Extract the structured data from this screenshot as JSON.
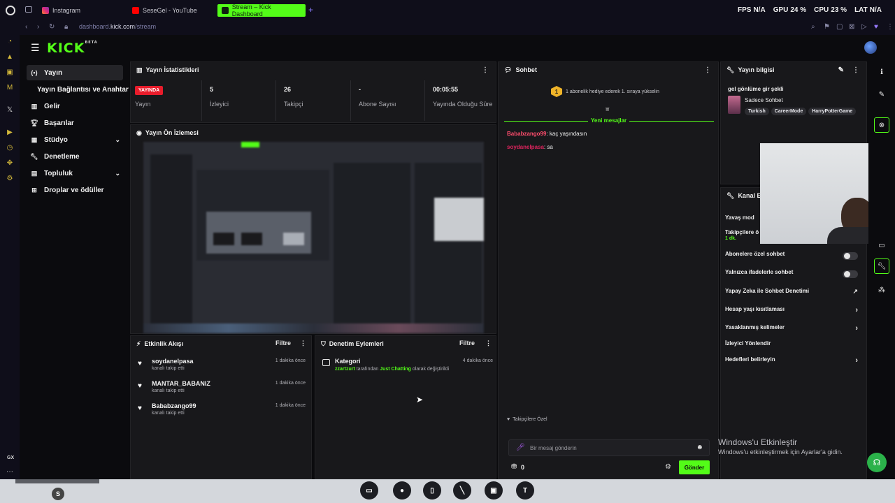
{
  "browser": {
    "tabs": [
      {
        "label": "Instagram",
        "color": "#d6249f"
      },
      {
        "label": "SeseGel - YouTube",
        "color": "#ff0000"
      },
      {
        "label": "Stream – Kick Dashboard",
        "color": "#53fc18"
      }
    ],
    "url_prefix": "dashboard.",
    "url_host": "kick.com",
    "url_path": "/stream",
    "stats_overlay": {
      "fps_label": "FPS",
      "fps_value": "N/A",
      "gpu_label": "GPU",
      "gpu_value": "24 %",
      "cpu_label": "CPU",
      "cpu_value": "23 %",
      "lat_label": "LAT",
      "lat_value": "N/A"
    }
  },
  "brand": {
    "logo_text": "KICK",
    "logo_badge": "BETA",
    "accent": "#53fc18"
  },
  "sidebar": {
    "items": [
      {
        "label": "Yayın",
        "icon": "broadcast-icon",
        "active": true
      },
      {
        "label": "Yayın Bağlantısı ve Anahtarı",
        "icon": "",
        "active": false
      },
      {
        "label": "Gelir",
        "icon": "chart-icon"
      },
      {
        "label": "Başarılar",
        "icon": "trophy-icon"
      },
      {
        "label": "Stüdyo",
        "icon": "grid-icon",
        "expandable": true
      },
      {
        "label": "Denetleme",
        "icon": "wrench-icon"
      },
      {
        "label": "Topluluk",
        "icon": "community-icon",
        "expandable": true
      },
      {
        "label": "Droplar ve ödüller",
        "icon": "gift-icon"
      }
    ]
  },
  "stats": {
    "title": "Yayın İstatistikleri",
    "live_badge": "YAYINDA",
    "live_label": "Yayın",
    "cells": [
      {
        "value": "5",
        "label": "İzleyici"
      },
      {
        "value": "26",
        "label": "Takipçi"
      },
      {
        "value": "-",
        "label": "Abone Sayısı"
      },
      {
        "value": "00:05:55",
        "label": "Yayında Olduğu Süre"
      }
    ]
  },
  "preview": {
    "title": "Yayın Ön İzlemesi"
  },
  "activity": {
    "title": "Etkinlik Akışı",
    "filter_label": "Filtre",
    "items": [
      {
        "name": "soydanelpasa",
        "sub": "kanalı takip etti",
        "time": "1 dakika önce"
      },
      {
        "name": "MANTAR_BABANIZ",
        "sub": "kanalı takip etti",
        "time": "1 dakika önce"
      },
      {
        "name": "Bababzango99",
        "sub": "kanalı takip etti",
        "time": "1 dakika önce"
      }
    ]
  },
  "moderation": {
    "title": "Denetim Eylemleri",
    "filter_label": "Filtre",
    "items": [
      {
        "title": "Kategori",
        "actor": "zzartzurt",
        "middle": "tarafından",
        "category": "Just Chatting",
        "suffix": "olarak değiştirildi",
        "time": "4 dakika önce"
      }
    ]
  },
  "chat": {
    "title": "Sohbet",
    "gift_count": "1",
    "gift_text": "1 abonelik hediye ederek 1. sıraya yükselin",
    "new_messages": "Yeni mesajlar",
    "messages": [
      {
        "user": "Bababzango99",
        "text": "kaç yaşındasın",
        "color": "#ff4d6d"
      },
      {
        "user": "soydanelpasa",
        "text": "sa",
        "color": "#e0245e"
      }
    ],
    "followers_only": "Takipçilere Özel",
    "input_placeholder": "Bir mesaj gönderin",
    "points": "0",
    "send_label": "Gönder"
  },
  "stream_info": {
    "title": "Yayın bilgisi",
    "stream_title": "gel gönlüme gir şekli",
    "category": "Sadece Sohbet",
    "tags": [
      "Turkish",
      "CareerMode",
      "HarryPotterGame"
    ]
  },
  "channel_actions": {
    "title": "Kanal Eyl",
    "rows": [
      {
        "label": "Yavaş mod",
        "type": "none"
      },
      {
        "label": "Takipçilere ö",
        "type": "none",
        "sub": "1 dk."
      },
      {
        "label": "Abonelere özel sohbet",
        "type": "toggle"
      },
      {
        "label": "Yalnızca ifadelerle sohbet",
        "type": "toggle"
      },
      {
        "label": "Yapay Zeka ile Sohbet Denetimi",
        "type": "external"
      },
      {
        "label": "Hesap yaşı kısıtlaması",
        "type": "chevron"
      },
      {
        "label": "Yasaklanmış kelimeler",
        "type": "chevron"
      },
      {
        "label": "İzleyici Yönlendir",
        "type": "none"
      },
      {
        "label": "Hedefleri belirleyin",
        "type": "chevron"
      }
    ]
  },
  "windows_watermark": {
    "title": "Windows'u Etkinleştir",
    "subtitle": "Windows'u etkinleştirmek için Ayarlar'a gidin."
  },
  "left_strip_label": "GX"
}
